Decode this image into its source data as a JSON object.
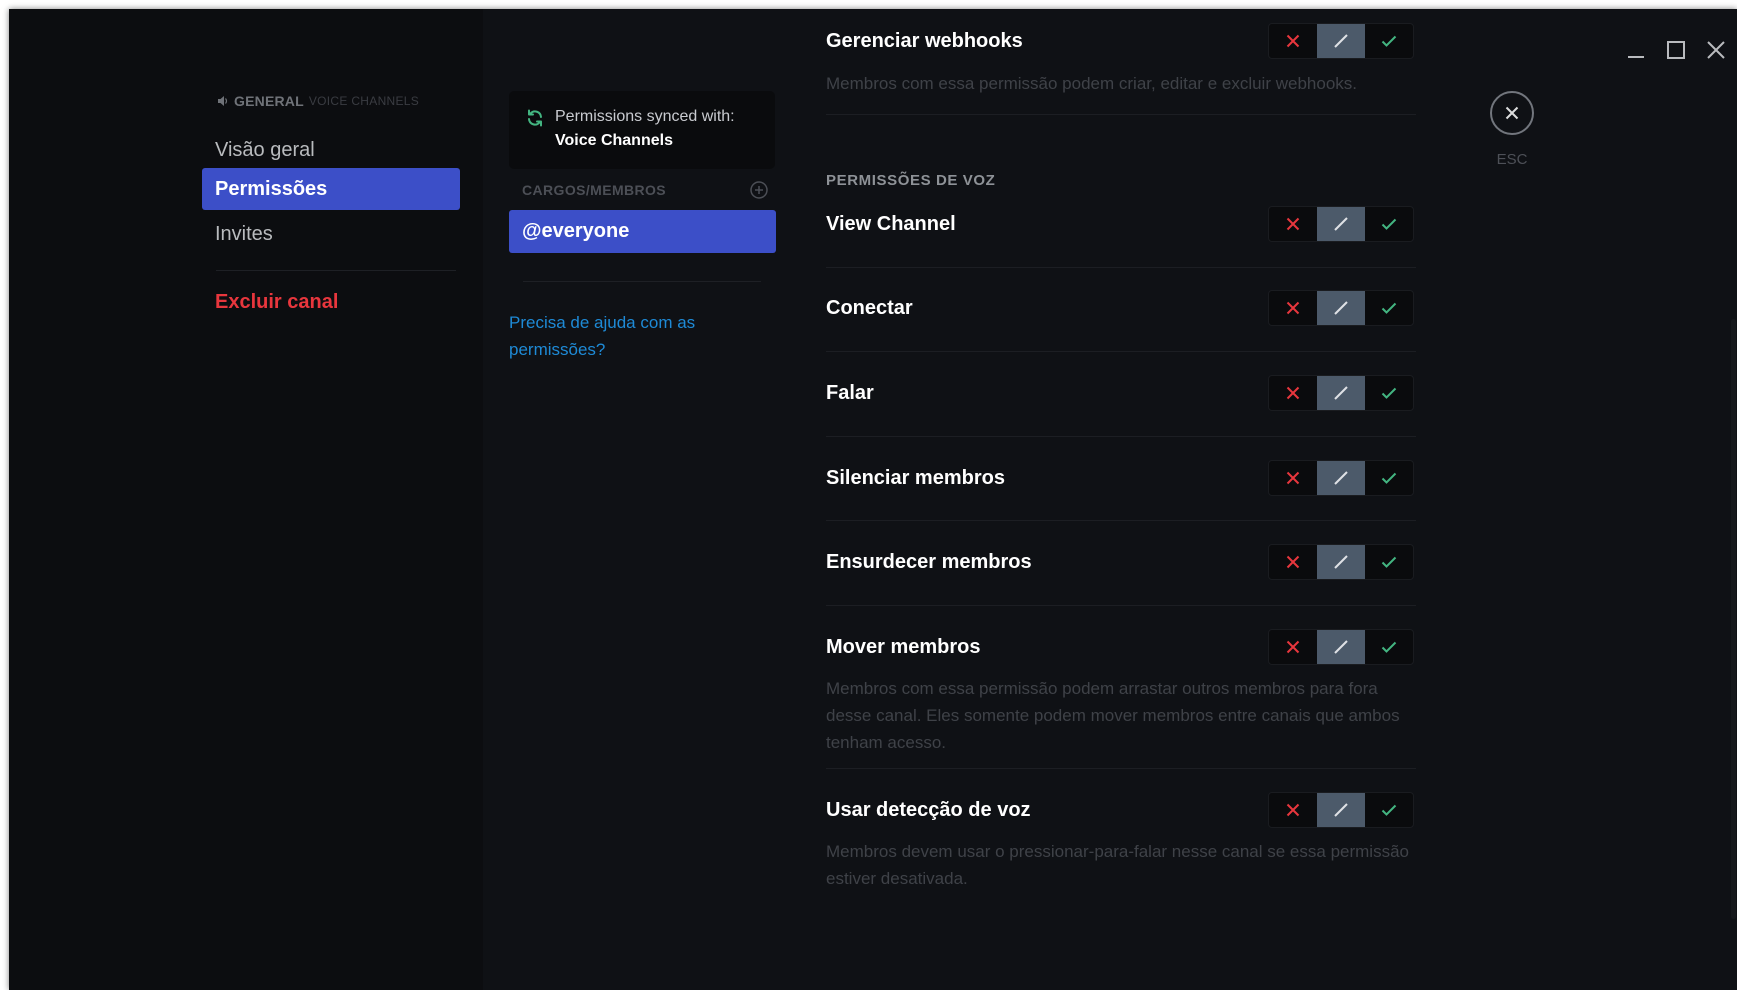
{
  "window_controls": {
    "minimize": "minimize-icon",
    "maximize": "maximize-icon",
    "close": "close-icon"
  },
  "sidebar": {
    "header": {
      "channel": "GENERAL",
      "category": "VOICE CHANNELS",
      "icon": "speaker-icon"
    },
    "items": [
      {
        "label": "Visão geral",
        "active": false
      },
      {
        "label": "Permissões",
        "active": true
      },
      {
        "label": "Invites",
        "active": false
      }
    ],
    "delete_label": "Excluir canal"
  },
  "roles_panel": {
    "sync": {
      "text": "Permissions synced with:",
      "channel": "Voice Channels",
      "icon": "sync-icon"
    },
    "header": "CARGOS/MEMBROS",
    "roles": [
      "@everyone"
    ],
    "help_link": "Precisa de ajuda com as permissões?"
  },
  "permissions": {
    "webhooks": {
      "title": "Gerenciar webhooks",
      "description": "Membros com essa permissão podem criar, editar e excluir webhooks.",
      "state": "neutral"
    },
    "voice_section_title": "PERMISSÕES DE VOZ",
    "voice": [
      {
        "title": "View Channel",
        "state": "neutral"
      },
      {
        "title": "Conectar",
        "state": "neutral"
      },
      {
        "title": "Falar",
        "state": "neutral"
      },
      {
        "title": "Silenciar membros",
        "state": "neutral"
      },
      {
        "title": "Ensurdecer membros",
        "state": "neutral"
      },
      {
        "title": "Mover membros",
        "description": "Membros com essa permissão podem arrastar outros membros para fora desse canal. Eles somente podem mover membros entre canais que ambos tenham acesso.",
        "state": "neutral"
      },
      {
        "title": "Usar detecção de voz",
        "description": "Membros devem usar o pressionar-para-falar nesse canal se essa permissão estiver desativada.",
        "state": "neutral"
      }
    ]
  },
  "esc": {
    "label": "ESC",
    "icon": "close-icon"
  },
  "colors": {
    "accent": "#3c4fc8",
    "deny": "#e8363d",
    "allow": "#43b581",
    "link": "#1e8ad6",
    "neutral_active": "#4c5a6a"
  }
}
